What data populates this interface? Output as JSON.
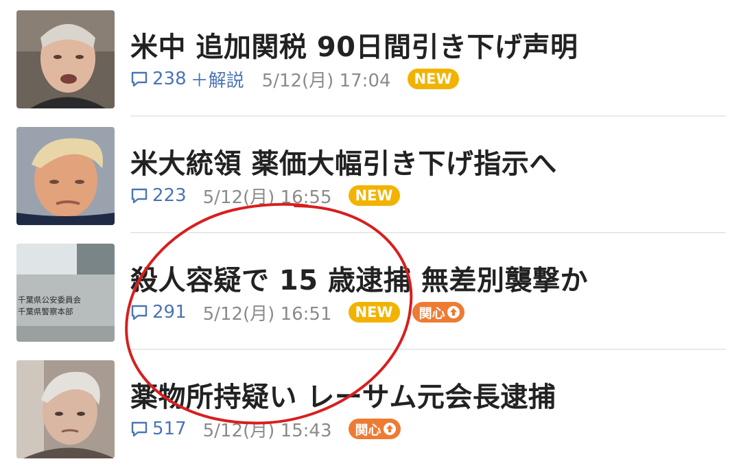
{
  "news": [
    {
      "headline": "米中 追加関税 90日間引き下げ声明",
      "comments": "238",
      "extra": "＋解説",
      "datetime": "5/12(月) 17:04",
      "badges": [
        "NEW"
      ],
      "thumbnail": "man-speaking-photo"
    },
    {
      "headline": "米大統領 薬価大幅引き下げ指示へ",
      "comments": "223",
      "extra": "",
      "datetime": "5/12(月) 16:55",
      "badges": [
        "NEW"
      ],
      "thumbnail": "president-portrait-photo"
    },
    {
      "headline": "殺人容疑で 15 歳逮捕 無差別襲撃か",
      "comments": "291",
      "extra": "",
      "datetime": "5/12(月) 16:51",
      "badges": [
        "NEW",
        "関心"
      ],
      "thumbnail": "police-building-sign-photo",
      "thumbnail_text": [
        "千葉県公安委員会",
        "千葉県警察本部"
      ]
    },
    {
      "headline": "薬物所持疑い レーサム元会長逮捕",
      "comments": "517",
      "extra": "",
      "datetime": "5/12(月) 15:43",
      "badges": [
        "関心"
      ],
      "thumbnail": "elderly-man-photo"
    }
  ],
  "colors": {
    "headline": "#222222",
    "comment_count": "#4a74b5",
    "datetime": "#8a8a8a",
    "badge_new": "#f2b300",
    "badge_interest": "#ee7b33",
    "annotation_circle": "#d81e1e"
  },
  "icons": {
    "comment": "speech-bubble-icon",
    "interest_up": "arrow-up-icon"
  }
}
